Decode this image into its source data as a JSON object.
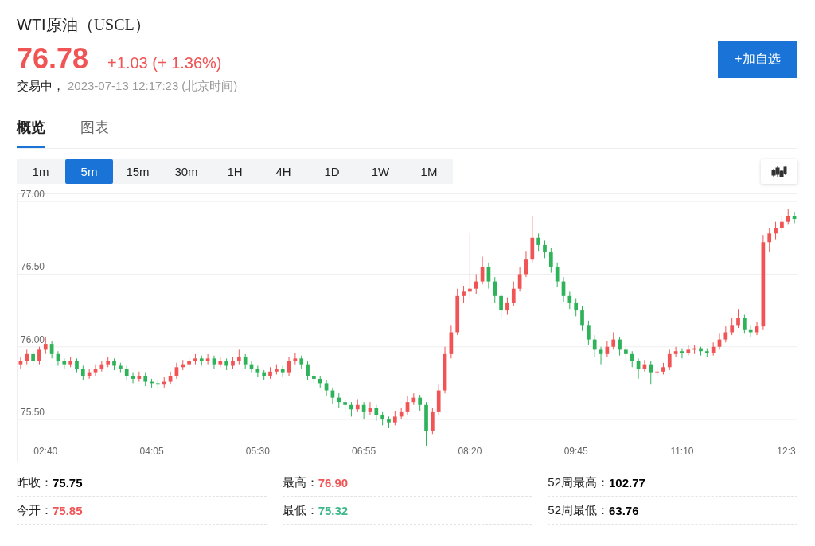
{
  "header": {
    "name": "WTI原油",
    "code": "（USCL）",
    "price": "76.78",
    "change": "+1.03 (+ 1.36%)",
    "status": "交易中，",
    "time": "2023-07-13 12:17:23",
    "timezone": "(北京时间)"
  },
  "add_button": "+加自选",
  "tabs": [
    {
      "label": "概览",
      "selected": true
    },
    {
      "label": "图表",
      "selected": false
    }
  ],
  "intervals": [
    {
      "label": "1m",
      "selected": false
    },
    {
      "label": "5m",
      "selected": true
    },
    {
      "label": "15m",
      "selected": false
    },
    {
      "label": "30m",
      "selected": false
    },
    {
      "label": "1H",
      "selected": false
    },
    {
      "label": "4H",
      "selected": false
    },
    {
      "label": "1D",
      "selected": false
    },
    {
      "label": "1W",
      "selected": false
    },
    {
      "label": "1M",
      "selected": false
    }
  ],
  "chart": {
    "chart_data": {
      "type": "candlestick",
      "categories": [
        null,
        null,
        null,
        null,
        "02:40",
        null,
        null,
        null,
        null,
        null,
        null,
        null,
        null,
        null,
        null,
        null,
        null,
        null,
        null,
        null,
        null,
        "04:05",
        null,
        null,
        null,
        null,
        null,
        null,
        null,
        null,
        null,
        null,
        null,
        null,
        null,
        null,
        null,
        null,
        "05:30",
        null,
        null,
        null,
        null,
        null,
        null,
        null,
        null,
        null,
        null,
        null,
        null,
        null,
        null,
        null,
        null,
        "06:55",
        null,
        null,
        null,
        null,
        null,
        null,
        null,
        null,
        null,
        null,
        null,
        null,
        null,
        null,
        null,
        null,
        "08:20",
        null,
        null,
        null,
        null,
        null,
        null,
        null,
        null,
        null,
        null,
        null,
        null,
        null,
        null,
        null,
        null,
        "09:45",
        null,
        null,
        null,
        null,
        null,
        null,
        null,
        null,
        null,
        null,
        null,
        null,
        null,
        null,
        null,
        null,
        "11:10",
        null,
        null,
        null,
        null,
        null,
        null,
        null,
        null,
        null,
        null,
        null,
        null,
        null,
        null,
        null,
        null,
        "12:3",
        null
      ],
      "ohlc": [
        [
          75.88,
          75.93,
          75.85,
          75.9
        ],
        [
          75.9,
          75.98,
          75.88,
          75.95
        ],
        [
          75.95,
          75.97,
          75.87,
          75.9
        ],
        [
          75.9,
          76.0,
          75.88,
          75.98
        ],
        [
          75.98,
          76.07,
          75.95,
          76.02
        ],
        [
          76.02,
          76.04,
          75.92,
          75.95
        ],
        [
          75.95,
          75.97,
          75.87,
          75.9
        ],
        [
          75.9,
          75.92,
          75.85,
          75.88
        ],
        [
          75.88,
          75.93,
          75.86,
          75.9
        ],
        [
          75.9,
          75.92,
          75.82,
          75.85
        ],
        [
          75.85,
          75.87,
          75.77,
          75.8
        ],
        [
          75.8,
          75.85,
          75.78,
          75.82
        ],
        [
          75.82,
          75.88,
          75.8,
          75.85
        ],
        [
          75.85,
          75.9,
          75.83,
          75.88
        ],
        [
          75.88,
          75.93,
          75.86,
          75.9
        ],
        [
          75.9,
          75.92,
          75.84,
          75.87
        ],
        [
          75.87,
          75.89,
          75.82,
          75.85
        ],
        [
          75.85,
          75.87,
          75.77,
          75.8
        ],
        [
          75.8,
          75.82,
          75.75,
          75.78
        ],
        [
          75.78,
          75.83,
          75.76,
          75.8
        ],
        [
          75.8,
          75.82,
          75.73,
          75.76
        ],
        [
          75.76,
          75.78,
          75.72,
          75.75
        ],
        [
          75.75,
          75.77,
          75.71,
          75.74
        ],
        [
          75.74,
          75.79,
          75.72,
          75.76
        ],
        [
          75.76,
          75.83,
          75.74,
          75.8
        ],
        [
          75.8,
          75.89,
          75.78,
          75.86
        ],
        [
          75.86,
          75.91,
          75.84,
          75.88
        ],
        [
          75.88,
          75.93,
          75.86,
          75.9
        ],
        [
          75.9,
          75.95,
          75.88,
          75.92
        ],
        [
          75.92,
          75.94,
          75.87,
          75.9
        ],
        [
          75.9,
          75.95,
          75.88,
          75.92
        ],
        [
          75.92,
          75.94,
          75.85,
          75.88
        ],
        [
          75.88,
          75.93,
          75.86,
          75.9
        ],
        [
          75.9,
          75.92,
          75.84,
          75.87
        ],
        [
          75.87,
          75.93,
          75.85,
          75.9
        ],
        [
          75.9,
          75.98,
          75.88,
          75.93
        ],
        [
          75.93,
          75.95,
          75.85,
          75.88
        ],
        [
          75.88,
          75.9,
          75.82,
          75.85
        ],
        [
          75.85,
          75.87,
          75.79,
          75.82
        ],
        [
          75.82,
          75.84,
          75.77,
          75.8
        ],
        [
          75.8,
          75.86,
          75.78,
          75.83
        ],
        [
          75.83,
          75.88,
          75.81,
          75.85
        ],
        [
          75.85,
          75.87,
          75.79,
          75.82
        ],
        [
          75.82,
          75.93,
          75.8,
          75.9
        ],
        [
          75.9,
          75.96,
          75.88,
          75.92
        ],
        [
          75.92,
          75.94,
          75.85,
          75.88
        ],
        [
          75.88,
          75.9,
          75.77,
          75.8
        ],
        [
          75.8,
          75.82,
          75.75,
          75.78
        ],
        [
          75.78,
          75.8,
          75.72,
          75.75
        ],
        [
          75.75,
          75.77,
          75.66,
          75.7
        ],
        [
          75.7,
          75.72,
          75.61,
          75.65
        ],
        [
          75.65,
          75.68,
          75.58,
          75.62
        ],
        [
          75.62,
          75.64,
          75.55,
          75.6
        ],
        [
          75.6,
          75.62,
          75.52,
          75.57
        ],
        [
          75.57,
          75.64,
          75.55,
          75.6
        ],
        [
          75.6,
          75.62,
          75.5,
          75.55
        ],
        [
          75.55,
          75.62,
          75.53,
          75.58
        ],
        [
          75.58,
          75.6,
          75.49,
          75.53
        ],
        [
          75.53,
          75.55,
          75.46,
          75.5
        ],
        [
          75.5,
          75.52,
          75.44,
          75.48
        ],
        [
          75.48,
          75.56,
          75.46,
          75.52
        ],
        [
          75.52,
          75.58,
          75.5,
          75.55
        ],
        [
          75.55,
          75.66,
          75.53,
          75.62
        ],
        [
          75.62,
          75.68,
          75.6,
          75.65
        ],
        [
          75.65,
          75.67,
          75.56,
          75.6
        ],
        [
          75.6,
          75.62,
          75.32,
          75.42
        ],
        [
          75.42,
          75.58,
          75.4,
          75.55
        ],
        [
          75.55,
          75.74,
          75.53,
          75.7
        ],
        [
          75.7,
          76.0,
          75.68,
          75.95
        ],
        [
          75.95,
          76.15,
          75.92,
          76.1
        ],
        [
          76.1,
          76.4,
          76.08,
          76.35
        ],
        [
          76.35,
          76.42,
          76.3,
          76.38
        ],
        [
          76.38,
          76.78,
          76.33,
          76.4
        ],
        [
          76.4,
          76.5,
          76.36,
          76.45
        ],
        [
          76.45,
          76.62,
          76.43,
          76.55
        ],
        [
          76.55,
          76.58,
          76.4,
          76.45
        ],
        [
          76.45,
          76.48,
          76.3,
          76.35
        ],
        [
          76.35,
          76.37,
          76.2,
          76.25
        ],
        [
          76.25,
          76.34,
          76.22,
          76.3
        ],
        [
          76.3,
          76.45,
          76.28,
          76.4
        ],
        [
          76.4,
          76.55,
          76.38,
          76.5
        ],
        [
          76.5,
          76.66,
          76.48,
          76.6
        ],
        [
          76.6,
          76.9,
          76.58,
          76.75
        ],
        [
          76.75,
          76.78,
          76.66,
          76.7
        ],
        [
          76.7,
          76.73,
          76.61,
          76.65
        ],
        [
          76.65,
          76.68,
          76.51,
          76.55
        ],
        [
          76.55,
          76.58,
          76.41,
          76.45
        ],
        [
          76.45,
          76.48,
          76.31,
          76.35
        ],
        [
          76.35,
          76.38,
          76.26,
          76.3
        ],
        [
          76.3,
          76.33,
          76.21,
          76.25
        ],
        [
          76.25,
          76.28,
          76.11,
          76.15
        ],
        [
          76.15,
          76.18,
          76.01,
          76.05
        ],
        [
          76.05,
          76.08,
          75.93,
          75.98
        ],
        [
          75.98,
          76.0,
          75.88,
          75.95
        ],
        [
          75.95,
          76.04,
          75.93,
          76.0
        ],
        [
          76.0,
          76.1,
          75.98,
          76.05
        ],
        [
          76.05,
          76.07,
          75.94,
          75.98
        ],
        [
          75.98,
          76.0,
          75.91,
          75.95
        ],
        [
          75.95,
          75.97,
          75.86,
          75.9
        ],
        [
          75.9,
          75.92,
          75.78,
          75.85
        ],
        [
          75.85,
          75.91,
          75.83,
          75.88
        ],
        [
          75.88,
          75.9,
          75.74,
          75.82
        ],
        [
          75.82,
          75.86,
          75.8,
          75.83
        ],
        [
          75.83,
          75.89,
          75.81,
          75.86
        ],
        [
          75.86,
          75.98,
          75.84,
          75.95
        ],
        [
          75.95,
          76.0,
          75.93,
          75.97
        ],
        [
          75.97,
          75.99,
          75.92,
          75.96
        ],
        [
          75.96,
          76.01,
          75.94,
          75.98
        ],
        [
          75.98,
          76.01,
          75.95,
          75.99
        ],
        [
          75.99,
          76.0,
          75.94,
          75.97
        ],
        [
          75.97,
          75.99,
          75.93,
          75.96
        ],
        [
          75.96,
          76.03,
          75.94,
          76.0
        ],
        [
          76.0,
          76.09,
          75.98,
          76.05
        ],
        [
          76.05,
          76.14,
          76.03,
          76.1
        ],
        [
          76.1,
          76.2,
          76.08,
          76.15
        ],
        [
          76.15,
          76.26,
          76.13,
          76.2
        ],
        [
          76.2,
          76.22,
          76.09,
          76.12
        ],
        [
          76.12,
          76.15,
          76.07,
          76.1
        ],
        [
          76.1,
          76.17,
          76.08,
          76.14
        ],
        [
          76.14,
          76.77,
          76.12,
          76.72
        ],
        [
          76.72,
          76.82,
          76.65,
          76.78
        ],
        [
          76.78,
          76.86,
          76.74,
          76.82
        ],
        [
          76.82,
          76.9,
          76.79,
          76.86
        ],
        [
          76.86,
          76.95,
          76.84,
          76.9
        ],
        [
          76.9,
          76.93,
          76.85,
          76.88
        ]
      ],
      "ylim": [
        75.21,
        77.05
      ],
      "grid": true,
      "yticks": [
        {
          "value": 77,
          "label": "77.00"
        },
        {
          "value": 76.5,
          "label": "76.50"
        },
        {
          "value": 76,
          "label": "76.00"
        },
        {
          "value": 75.5,
          "label": "75.50"
        }
      ]
    }
  },
  "stats": [
    {
      "label": "昨收：",
      "value": "75.75",
      "color": "#000000"
    },
    {
      "label": "最高：",
      "value": "76.90",
      "color": "#f05454"
    },
    {
      "label": "52周最高：",
      "value": "102.77",
      "color": "#000000"
    },
    {
      "label": "今开：",
      "value": "75.85",
      "color": "#f05454"
    },
    {
      "label": "最低：",
      "value": "75.32",
      "color": "#3cb88a"
    },
    {
      "label": "52周最低：",
      "value": "63.76",
      "color": "#000000"
    }
  ]
}
